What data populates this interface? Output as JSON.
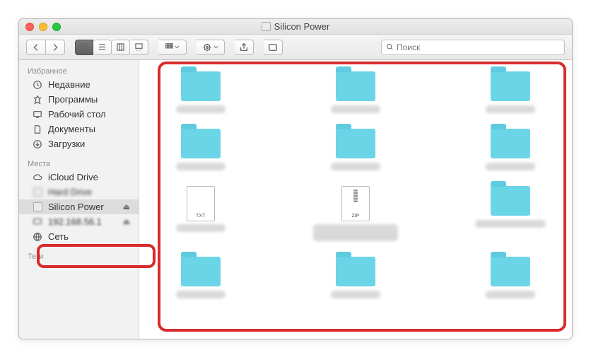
{
  "window": {
    "title": "Silicon Power"
  },
  "search": {
    "placeholder": "Поиск"
  },
  "sidebar": {
    "favorites_label": "Избранное",
    "locations_label": "Места",
    "tags_label": "Теги",
    "favorites": [
      {
        "label": "Недавние",
        "icon": "clock"
      },
      {
        "label": "Программы",
        "icon": "apps"
      },
      {
        "label": "Рабочий стол",
        "icon": "desktop"
      },
      {
        "label": "Документы",
        "icon": "documents"
      },
      {
        "label": "Загрузки",
        "icon": "downloads"
      }
    ],
    "locations": [
      {
        "label": "iCloud Drive",
        "icon": "cloud",
        "ejectable": false,
        "selected": false
      },
      {
        "label": "Hard Drive",
        "icon": "drive",
        "ejectable": false,
        "selected": false,
        "blurred": true
      },
      {
        "label": "Silicon Power",
        "icon": "drive",
        "ejectable": true,
        "selected": true
      },
      {
        "label": "192.168.56.1",
        "icon": "network",
        "ejectable": true,
        "selected": false,
        "blurred": true
      },
      {
        "label": "Сеть",
        "icon": "globe",
        "ejectable": false,
        "selected": false
      }
    ]
  },
  "content": {
    "items": [
      {
        "type": "folder"
      },
      {
        "type": "folder"
      },
      {
        "type": "folder"
      },
      {
        "type": "folder"
      },
      {
        "type": "folder"
      },
      {
        "type": "folder"
      },
      {
        "type": "file",
        "ext": "TXT"
      },
      {
        "type": "file",
        "ext": "ZIP"
      },
      {
        "type": "folder"
      },
      {
        "type": "folder"
      },
      {
        "type": "folder"
      },
      {
        "type": "folder"
      }
    ]
  }
}
